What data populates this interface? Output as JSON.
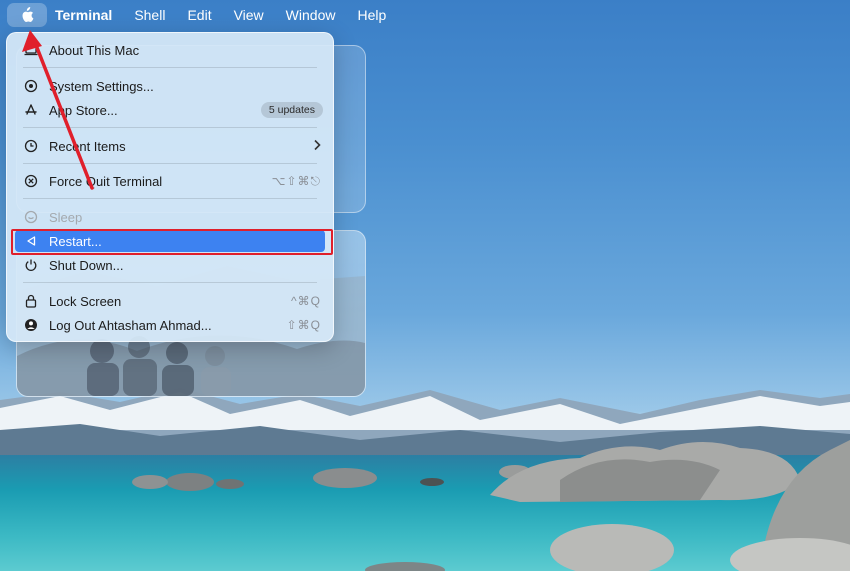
{
  "menubar": {
    "apple_icon": "apple-logo-icon",
    "items": [
      "Terminal",
      "Shell",
      "Edit",
      "View",
      "Window",
      "Help"
    ]
  },
  "apple_menu": {
    "about": "About This Mac",
    "system_settings": "System Settings...",
    "app_store": "App Store...",
    "app_store_badge": "5 updates",
    "recent_items": "Recent Items",
    "force_quit": "Force Quit Terminal",
    "force_quit_shortcut": "⌥⇧⌘⎋",
    "sleep": "Sleep",
    "restart": "Restart...",
    "shut_down": "Shut Down...",
    "lock_screen": "Lock Screen",
    "lock_screen_shortcut": "^⌘Q",
    "log_out": "Log Out Ahtasham Ahmad...",
    "log_out_shortcut": "⇧⌘Q"
  },
  "colors": {
    "highlight": "#3d82f1",
    "annotation_red": "#e01f2b"
  }
}
